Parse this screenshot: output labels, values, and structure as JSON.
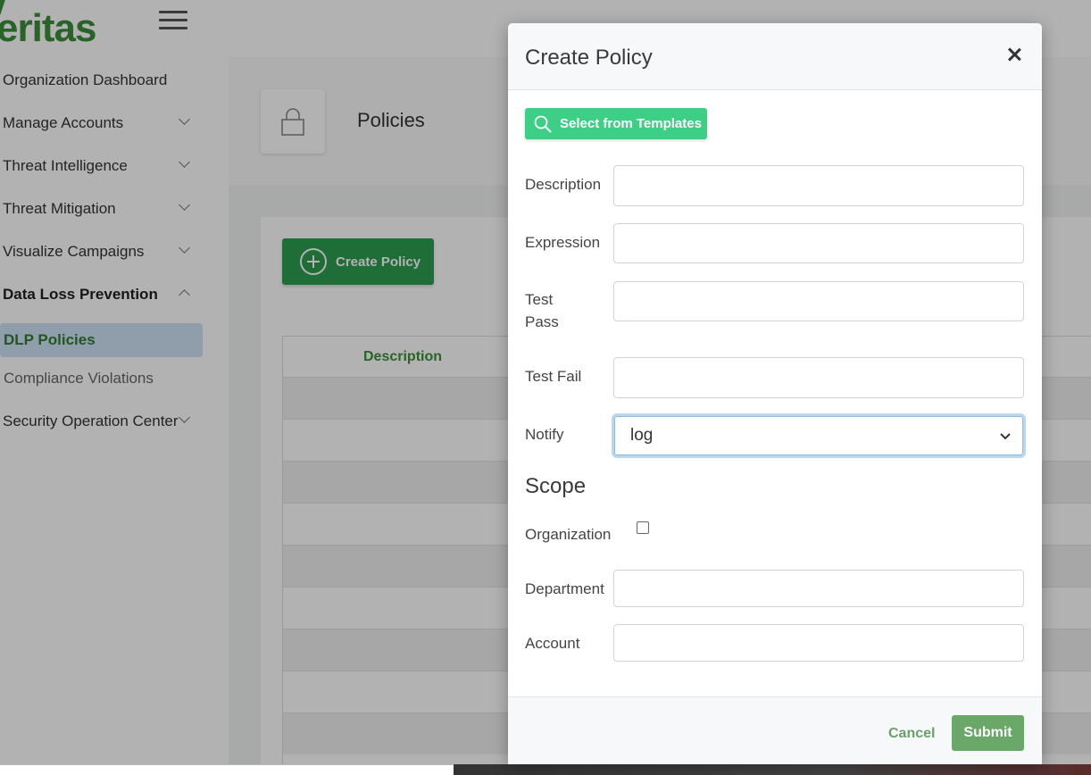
{
  "app": {
    "logo_text": "eritas",
    "page_title": "Policies",
    "create_button_label": "Create Policy",
    "table_headers": [
      "Description"
    ]
  },
  "sidebar": {
    "items": [
      {
        "label": "Organization Dashboard"
      },
      {
        "label": "Manage Accounts"
      },
      {
        "label": "Threat Intelligence"
      },
      {
        "label": "Threat Mitigation"
      },
      {
        "label": "Visualize Campaigns"
      },
      {
        "label": "Data Loss Prevention"
      },
      {
        "label": "DLP Policies"
      },
      {
        "label": "Compliance Violations"
      },
      {
        "label": "Security Operation Center"
      }
    ]
  },
  "modal": {
    "title": "Create Policy",
    "template_button_label": "Select from Templates",
    "fields": {
      "description": {
        "label": "Description",
        "value": ""
      },
      "expression": {
        "label": "Expression",
        "value": ""
      },
      "test_pass": {
        "label_line1": "Test",
        "label_line2": "Pass",
        "value": ""
      },
      "test_fail": {
        "label": "Test Fail",
        "value": ""
      },
      "notify": {
        "label": "Notify",
        "selected": "log"
      }
    },
    "scope": {
      "title": "Scope",
      "organization": {
        "label": "Organization",
        "checked": false
      },
      "department": {
        "label": "Department",
        "value": ""
      },
      "account": {
        "label": "Account",
        "value": ""
      }
    },
    "footer": {
      "cancel_label": "Cancel",
      "submit_label": "Submit"
    }
  },
  "colors": {
    "brand_green": "#3a8f3a",
    "create_button": "#2e9e4f",
    "template_button": "#3ecf86",
    "submit_button": "#6aa86a",
    "active_nav_bg": "#cfe3f5"
  }
}
